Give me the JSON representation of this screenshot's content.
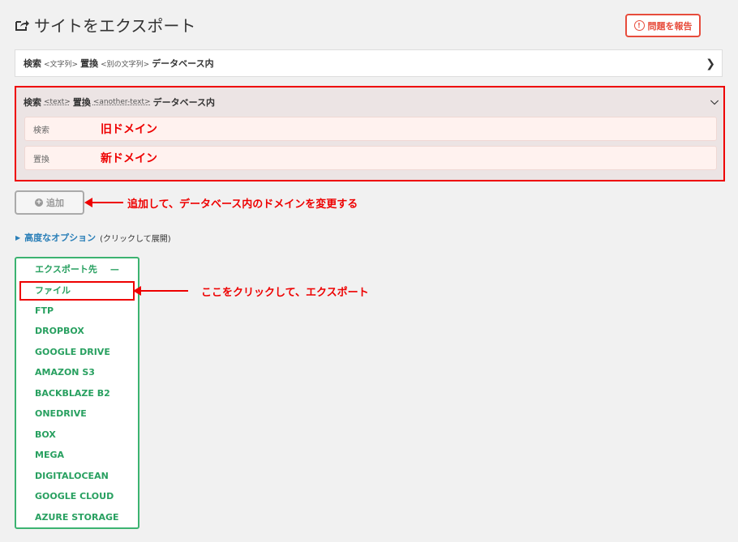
{
  "page": {
    "title": "サイトをエクスポート"
  },
  "report_button": {
    "label": "問題を報告"
  },
  "search_replace_collapsed": {
    "search_label": "検索",
    "search_placeholder": "<文字列>",
    "replace_label": "置換",
    "replace_placeholder": "<別の文字列>",
    "suffix": "データベース内"
  },
  "search_replace_expanded": {
    "search_label": "検索",
    "search_placeholder": "<text>",
    "replace_label": "置換",
    "replace_placeholder": "<another-text>",
    "suffix": "データベース内",
    "fields": [
      {
        "label": "検索",
        "value": "旧ドメイン"
      },
      {
        "label": "置換",
        "value": "新ドメイン"
      }
    ]
  },
  "add_button": {
    "label": "追加"
  },
  "annotations": {
    "add_note": "追加して、データベース内のドメインを変更する",
    "export_note": "ここをクリックして、エクスポート"
  },
  "advanced": {
    "link": "高度なオプション",
    "note": "(クリックして展開)"
  },
  "export": {
    "header": "エクスポート先",
    "collapse_symbol": "—",
    "items": [
      "ファイル",
      "FTP",
      "DROPBOX",
      "GOOGLE DRIVE",
      "AMAZON S3",
      "BACKBLAZE B2",
      "ONEDRIVE",
      "BOX",
      "MEGA",
      "DIGITALOCEAN",
      "GOOGLE CLOUD",
      "AZURE STORAGE"
    ]
  },
  "colors": {
    "accent_red": "#e00000",
    "export_green": "#28a060",
    "link_blue": "#2a7fb8"
  }
}
